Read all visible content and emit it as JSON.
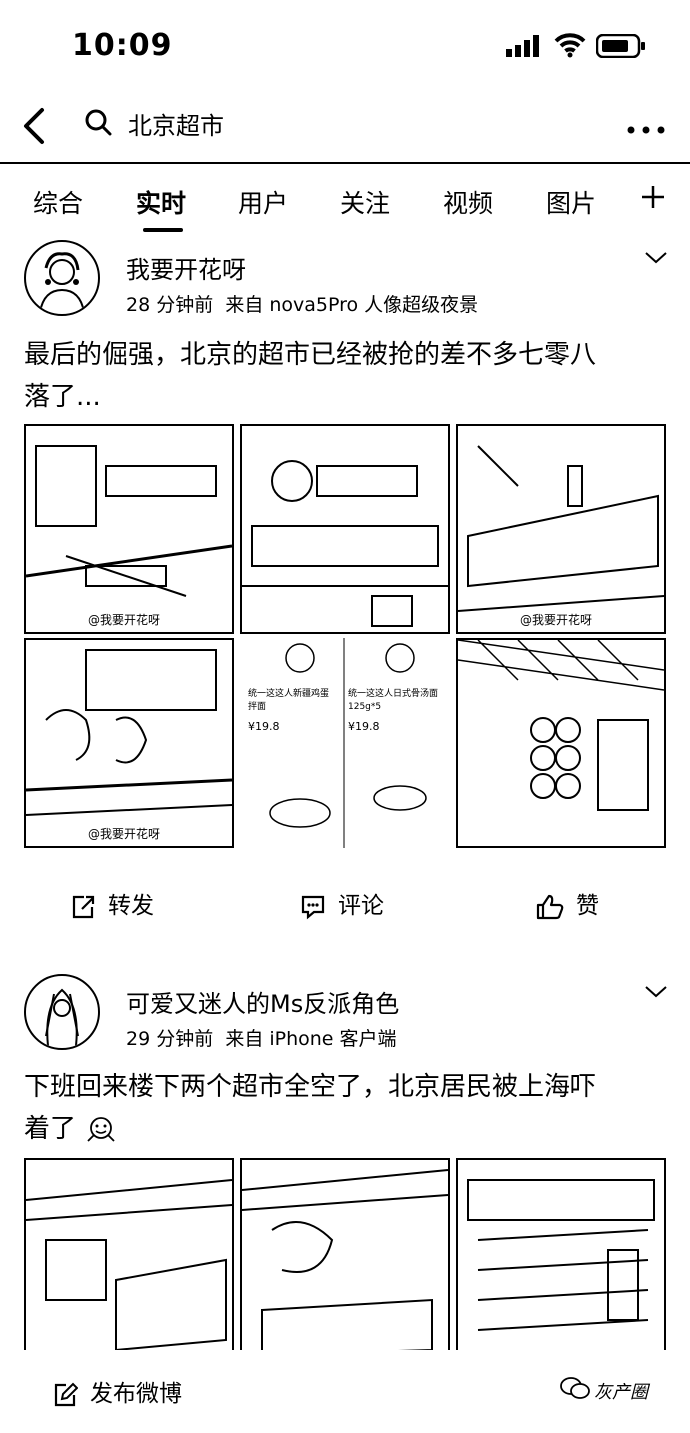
{
  "status_bar": {
    "time": "10:09"
  },
  "search": {
    "query": "北京超市"
  },
  "tabs": [
    "综合",
    "实时",
    "用户",
    "关注",
    "视频",
    "图片"
  ],
  "posts": [
    {
      "username": "我要开花呀",
      "time": "28 分钟前",
      "source": "来自 nova5Pro 人像超级夜景",
      "text_line1": "最后的倔强，北京的超市已经被抢的差不多七零八",
      "text_line2": "落了...",
      "watermark": "@我要开花呀",
      "product_cards": [
        {
          "name": "统一这这人新疆鸡蛋拌面",
          "price": "¥19.8"
        },
        {
          "name": "统一这这人日式骨汤面125g*5",
          "price": "¥19.8"
        }
      ]
    },
    {
      "username": "可爱又迷人的Ms反派角色",
      "time": "29 分钟前",
      "source": "来自 iPhone 客户端",
      "text_line1": "下班回来楼下两个超市全空了，北京居民被上海吓",
      "text_line2": "着了"
    }
  ],
  "actions": {
    "repost": "转发",
    "comment": "评论",
    "like": "赞"
  },
  "compose": {
    "label": "发布微博"
  },
  "brand": "灰产圈"
}
